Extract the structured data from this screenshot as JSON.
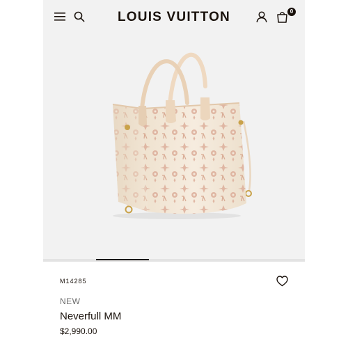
{
  "header": {
    "brand": "LOUIS VUITTON",
    "cart_count": "0",
    "icons": {
      "menu": "menu-icon",
      "search": "search-icon",
      "account": "account-icon",
      "cart": "shopping-bag-icon"
    }
  },
  "gallery": {
    "image": "tote-bag-image",
    "slide_count": 5,
    "active_slide": 2
  },
  "product": {
    "sku": "M14285",
    "badge": "NEW",
    "name": "Neverfull MM",
    "price": "$2,990.00"
  },
  "colors": {
    "background": "#f2f2f2",
    "ink": "#19110b",
    "bag_body": "#f3e7d7",
    "monogram": "#dcae9a",
    "hardware": "#c9a24a"
  }
}
